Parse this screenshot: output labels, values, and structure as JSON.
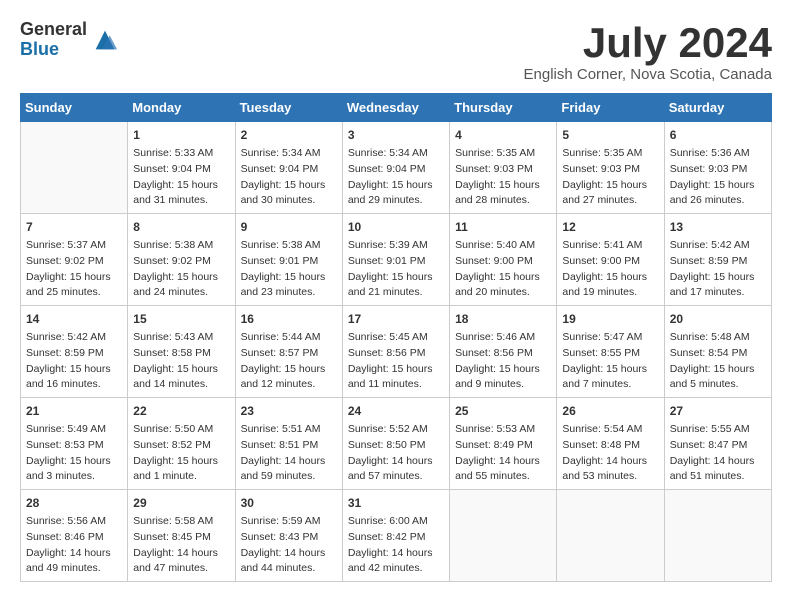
{
  "header": {
    "logo": {
      "general": "General",
      "blue": "Blue"
    },
    "title": "July 2024",
    "location": "English Corner, Nova Scotia, Canada"
  },
  "calendar": {
    "days_of_week": [
      "Sunday",
      "Monday",
      "Tuesday",
      "Wednesday",
      "Thursday",
      "Friday",
      "Saturday"
    ],
    "weeks": [
      [
        {
          "day": "",
          "content": ""
        },
        {
          "day": "1",
          "content": "Sunrise: 5:33 AM\nSunset: 9:04 PM\nDaylight: 15 hours\nand 31 minutes."
        },
        {
          "day": "2",
          "content": "Sunrise: 5:34 AM\nSunset: 9:04 PM\nDaylight: 15 hours\nand 30 minutes."
        },
        {
          "day": "3",
          "content": "Sunrise: 5:34 AM\nSunset: 9:04 PM\nDaylight: 15 hours\nand 29 minutes."
        },
        {
          "day": "4",
          "content": "Sunrise: 5:35 AM\nSunset: 9:03 PM\nDaylight: 15 hours\nand 28 minutes."
        },
        {
          "day": "5",
          "content": "Sunrise: 5:35 AM\nSunset: 9:03 PM\nDaylight: 15 hours\nand 27 minutes."
        },
        {
          "day": "6",
          "content": "Sunrise: 5:36 AM\nSunset: 9:03 PM\nDaylight: 15 hours\nand 26 minutes."
        }
      ],
      [
        {
          "day": "7",
          "content": "Sunrise: 5:37 AM\nSunset: 9:02 PM\nDaylight: 15 hours\nand 25 minutes."
        },
        {
          "day": "8",
          "content": "Sunrise: 5:38 AM\nSunset: 9:02 PM\nDaylight: 15 hours\nand 24 minutes."
        },
        {
          "day": "9",
          "content": "Sunrise: 5:38 AM\nSunset: 9:01 PM\nDaylight: 15 hours\nand 23 minutes."
        },
        {
          "day": "10",
          "content": "Sunrise: 5:39 AM\nSunset: 9:01 PM\nDaylight: 15 hours\nand 21 minutes."
        },
        {
          "day": "11",
          "content": "Sunrise: 5:40 AM\nSunset: 9:00 PM\nDaylight: 15 hours\nand 20 minutes."
        },
        {
          "day": "12",
          "content": "Sunrise: 5:41 AM\nSunset: 9:00 PM\nDaylight: 15 hours\nand 19 minutes."
        },
        {
          "day": "13",
          "content": "Sunrise: 5:42 AM\nSunset: 8:59 PM\nDaylight: 15 hours\nand 17 minutes."
        }
      ],
      [
        {
          "day": "14",
          "content": "Sunrise: 5:42 AM\nSunset: 8:59 PM\nDaylight: 15 hours\nand 16 minutes."
        },
        {
          "day": "15",
          "content": "Sunrise: 5:43 AM\nSunset: 8:58 PM\nDaylight: 15 hours\nand 14 minutes."
        },
        {
          "day": "16",
          "content": "Sunrise: 5:44 AM\nSunset: 8:57 PM\nDaylight: 15 hours\nand 12 minutes."
        },
        {
          "day": "17",
          "content": "Sunrise: 5:45 AM\nSunset: 8:56 PM\nDaylight: 15 hours\nand 11 minutes."
        },
        {
          "day": "18",
          "content": "Sunrise: 5:46 AM\nSunset: 8:56 PM\nDaylight: 15 hours\nand 9 minutes."
        },
        {
          "day": "19",
          "content": "Sunrise: 5:47 AM\nSunset: 8:55 PM\nDaylight: 15 hours\nand 7 minutes."
        },
        {
          "day": "20",
          "content": "Sunrise: 5:48 AM\nSunset: 8:54 PM\nDaylight: 15 hours\nand 5 minutes."
        }
      ],
      [
        {
          "day": "21",
          "content": "Sunrise: 5:49 AM\nSunset: 8:53 PM\nDaylight: 15 hours\nand 3 minutes."
        },
        {
          "day": "22",
          "content": "Sunrise: 5:50 AM\nSunset: 8:52 PM\nDaylight: 15 hours\nand 1 minute."
        },
        {
          "day": "23",
          "content": "Sunrise: 5:51 AM\nSunset: 8:51 PM\nDaylight: 14 hours\nand 59 minutes."
        },
        {
          "day": "24",
          "content": "Sunrise: 5:52 AM\nSunset: 8:50 PM\nDaylight: 14 hours\nand 57 minutes."
        },
        {
          "day": "25",
          "content": "Sunrise: 5:53 AM\nSunset: 8:49 PM\nDaylight: 14 hours\nand 55 minutes."
        },
        {
          "day": "26",
          "content": "Sunrise: 5:54 AM\nSunset: 8:48 PM\nDaylight: 14 hours\nand 53 minutes."
        },
        {
          "day": "27",
          "content": "Sunrise: 5:55 AM\nSunset: 8:47 PM\nDaylight: 14 hours\nand 51 minutes."
        }
      ],
      [
        {
          "day": "28",
          "content": "Sunrise: 5:56 AM\nSunset: 8:46 PM\nDaylight: 14 hours\nand 49 minutes."
        },
        {
          "day": "29",
          "content": "Sunrise: 5:58 AM\nSunset: 8:45 PM\nDaylight: 14 hours\nand 47 minutes."
        },
        {
          "day": "30",
          "content": "Sunrise: 5:59 AM\nSunset: 8:43 PM\nDaylight: 14 hours\nand 44 minutes."
        },
        {
          "day": "31",
          "content": "Sunrise: 6:00 AM\nSunset: 8:42 PM\nDaylight: 14 hours\nand 42 minutes."
        },
        {
          "day": "",
          "content": ""
        },
        {
          "day": "",
          "content": ""
        },
        {
          "day": "",
          "content": ""
        }
      ]
    ]
  }
}
